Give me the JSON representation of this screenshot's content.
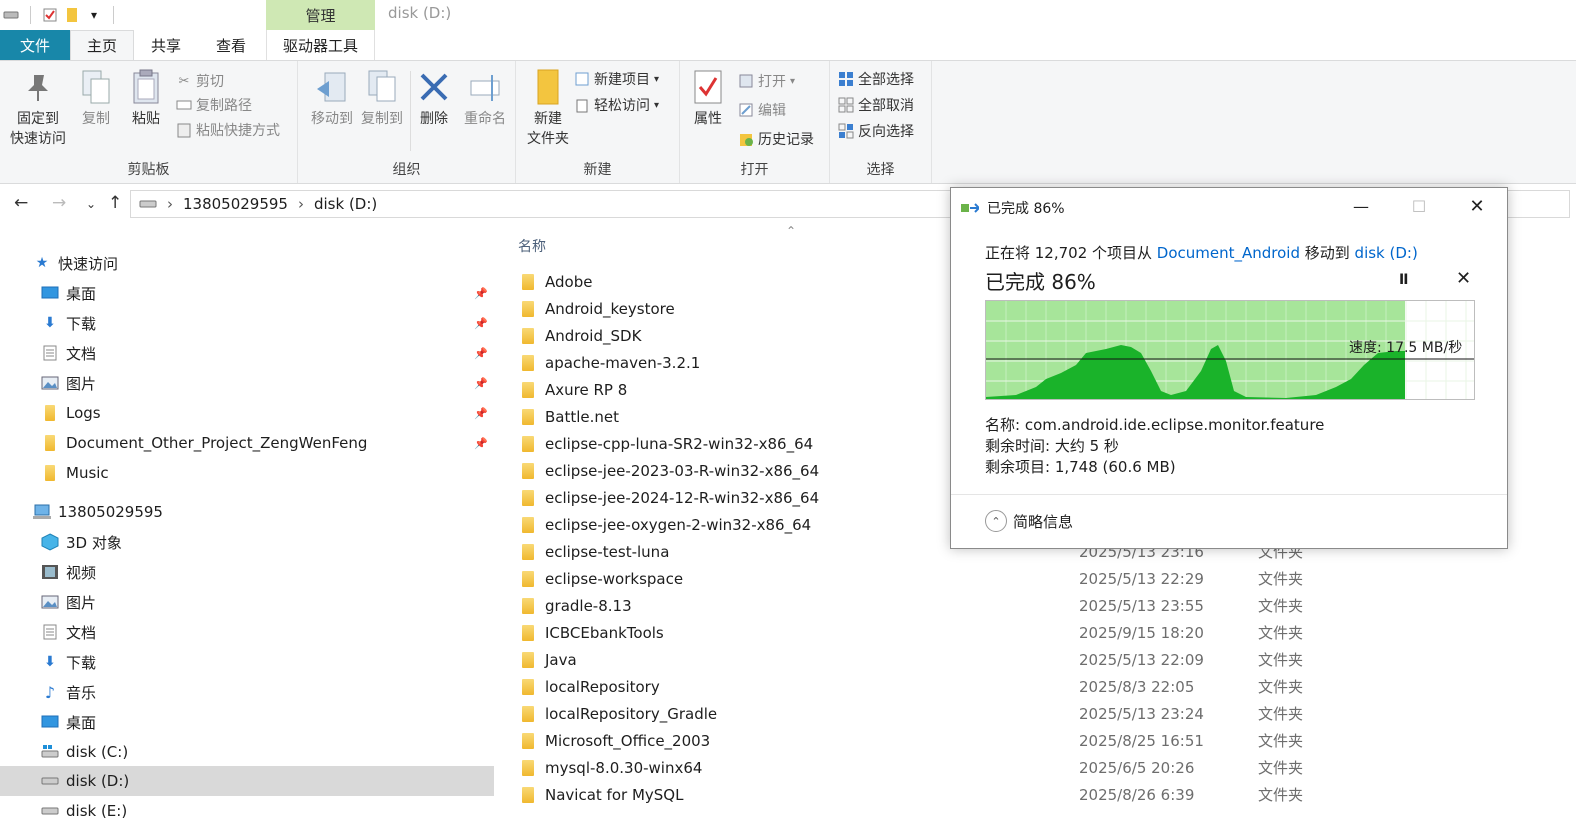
{
  "window": {
    "title": "disk (D:)",
    "manage_tab": "管理"
  },
  "ribbon_tabs": [
    {
      "label": "文件"
    },
    {
      "label": "主页"
    },
    {
      "label": "共享"
    },
    {
      "label": "查看"
    },
    {
      "label": "驱动器工具"
    }
  ],
  "ribbon": {
    "clipboard": {
      "label": "剪贴板",
      "pin_line1": "固定到",
      "pin_line2": "快速访问",
      "copy": "复制",
      "paste": "粘贴",
      "cut": "剪切",
      "copy_path": "复制路径",
      "paste_shortcut": "粘贴快捷方式"
    },
    "organize": {
      "label": "组织",
      "move_to": "移动到",
      "copy_to": "复制到",
      "delete": "删除",
      "rename": "重命名"
    },
    "new": {
      "label": "新建",
      "new_folder_line1": "新建",
      "new_folder_line2": "文件夹",
      "new_item": "新建项目",
      "easy_access": "轻松访问"
    },
    "open": {
      "label": "打开",
      "properties": "属性",
      "open": "打开",
      "edit": "编辑",
      "history": "历史记录"
    },
    "select": {
      "label": "选择",
      "select_all": "全部选择",
      "select_none": "全部取消",
      "invert": "反向选择"
    }
  },
  "address": {
    "crumbs": [
      "13805029595",
      "disk (D:)"
    ]
  },
  "sidebar": {
    "quick_access": "快速访问",
    "quick_items": [
      {
        "label": "桌面",
        "icon": "desktop-icon"
      },
      {
        "label": "下载",
        "icon": "download-icon"
      },
      {
        "label": "文档",
        "icon": "document-icon"
      },
      {
        "label": "图片",
        "icon": "picture-icon"
      },
      {
        "label": "Logs",
        "icon": "folder-icon"
      },
      {
        "label": "Document_Other_Project_ZengWenFeng",
        "icon": "folder-icon"
      },
      {
        "label": "Music",
        "icon": "folder-icon"
      }
    ],
    "this_pc": "13805029595",
    "pc_items": [
      {
        "label": "3D 对象",
        "icon": "3d-objects-icon"
      },
      {
        "label": "视频",
        "icon": "video-icon"
      },
      {
        "label": "图片",
        "icon": "picture-icon"
      },
      {
        "label": "文档",
        "icon": "document-icon"
      },
      {
        "label": "下载",
        "icon": "download-icon"
      },
      {
        "label": "音乐",
        "icon": "music-icon"
      },
      {
        "label": "桌面",
        "icon": "desktop-icon"
      },
      {
        "label": "disk (C:)",
        "icon": "drive-icon"
      },
      {
        "label": "disk (D:)",
        "icon": "drive-icon"
      },
      {
        "label": "disk (E:)",
        "icon": "drive-icon"
      }
    ]
  },
  "file_list": {
    "column_name": "名称",
    "rows": [
      {
        "name": "Adobe",
        "date": "",
        "type": ""
      },
      {
        "name": "Android_keystore",
        "date": "",
        "type": ""
      },
      {
        "name": "Android_SDK",
        "date": "",
        "type": ""
      },
      {
        "name": "apache-maven-3.2.1",
        "date": "",
        "type": ""
      },
      {
        "name": "Axure RP 8",
        "date": "",
        "type": ""
      },
      {
        "name": "Battle.net",
        "date": "",
        "type": ""
      },
      {
        "name": "eclipse-cpp-luna-SR2-win32-x86_64",
        "date": "",
        "type": ""
      },
      {
        "name": "eclipse-jee-2023-03-R-win32-x86_64",
        "date": "",
        "type": ""
      },
      {
        "name": "eclipse-jee-2024-12-R-win32-x86_64",
        "date": "",
        "type": ""
      },
      {
        "name": "eclipse-jee-oxygen-2-win32-x86_64",
        "date": "",
        "type": ""
      },
      {
        "name": "eclipse-test-luna",
        "date": "2025/5/13 23:16",
        "type": "文件夹"
      },
      {
        "name": "eclipse-workspace",
        "date": "2025/5/13 22:29",
        "type": "文件夹"
      },
      {
        "name": "gradle-8.13",
        "date": "2025/5/13 23:55",
        "type": "文件夹"
      },
      {
        "name": "ICBCEbankTools",
        "date": "2025/9/15 18:20",
        "type": "文件夹"
      },
      {
        "name": "Java",
        "date": "2025/5/13 22:09",
        "type": "文件夹"
      },
      {
        "name": "localRepository",
        "date": "2025/8/3 22:05",
        "type": "文件夹"
      },
      {
        "name": "localRepository_Gradle",
        "date": "2025/5/13 23:24",
        "type": "文件夹"
      },
      {
        "name": "Microsoft_Office_2003",
        "date": "2025/8/25 16:51",
        "type": "文件夹"
      },
      {
        "name": "mysql-8.0.30-winx64",
        "date": "2025/6/5 20:26",
        "type": "文件夹"
      },
      {
        "name": "Navicat for MySQL",
        "date": "2025/8/26 6:39",
        "type": "文件夹"
      }
    ]
  },
  "progress_dialog": {
    "title": "已完成 86%",
    "desc_prefix": "正在将 12,702 个项目从 ",
    "source": "Document_Android",
    "desc_mid": " 移动到 ",
    "dest": "disk (D:)",
    "big_status": "已完成 86%",
    "percent": 86,
    "speed": "速度: 17.5 MB/秒",
    "name_line": "名称: com.android.ide.eclipse.monitor.feature",
    "time_line": "剩余时间: 大约 5 秒",
    "items_line": "剩余项目: 1,748 (60.6 MB)",
    "brief": "简略信息",
    "colors": {
      "graph_fill": "#1ab32a",
      "graph_bg": "#a7e59a"
    }
  }
}
